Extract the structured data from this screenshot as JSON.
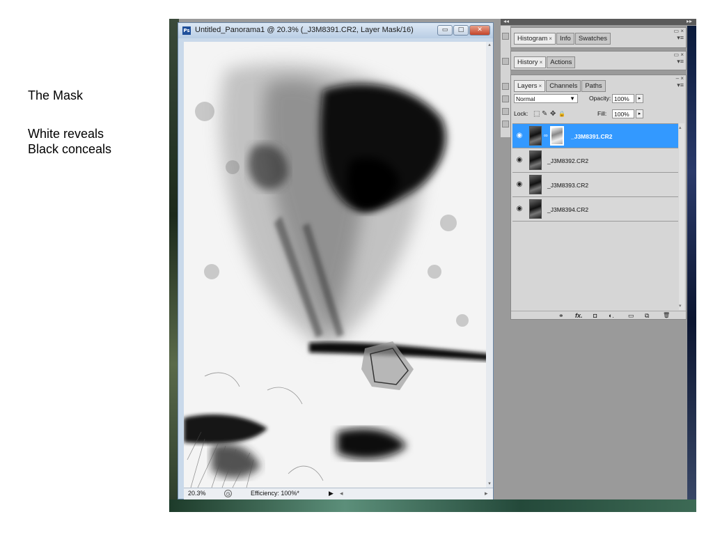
{
  "slide": {
    "title": "The Mask",
    "line1": "White reveals",
    "line2": "Black conceals"
  },
  "document": {
    "app_badge": "Ps",
    "title": "Untitled_Panorama1 @ 20.3% (_J3M8391.CR2, Layer Mask/16)",
    "minimize_glyph": "▭",
    "maximize_glyph": "□",
    "close_glyph": "✕",
    "status": {
      "zoom": "20.3%",
      "info_glyph": "◷",
      "efficiency": "Efficiency: 100%*",
      "arrow_glyph": "▶",
      "scroll_left_glyph": "◂",
      "scroll_right_glyph": "▸"
    },
    "scroll_up_glyph": "▴",
    "scroll_down_glyph": "▾"
  },
  "panels": {
    "collapse_left": "◂◂",
    "collapse_right": "▸▸",
    "histogram_group": {
      "tabs": [
        "Histogram",
        "Info",
        "Swatches"
      ],
      "close_glyph": "×",
      "menu_glyph": "▾≡",
      "min_glyph": "▭ ×"
    },
    "history_group": {
      "tabs": [
        "History",
        "Actions"
      ],
      "close_glyph": "×",
      "menu_glyph": "▾≡",
      "min_glyph": "▭ ×"
    },
    "layers_group": {
      "tabs": [
        "Layers",
        "Channels",
        "Paths"
      ],
      "close_glyph": "×",
      "menu_glyph": "▾≡",
      "min_glyph": "– ×",
      "blend_mode": "Normal",
      "blend_arrow": "▼",
      "opacity_label": "Opacity:",
      "opacity_value": "100%",
      "stepper_glyph": "▸",
      "lock_label": "Lock:",
      "lock_icons": [
        "⬚",
        "✎",
        "✥",
        "🔒"
      ],
      "fill_label": "Fill:",
      "fill_value": "100%",
      "eye_glyph": "◉",
      "chain_glyph": "∞",
      "layers": [
        {
          "name": "_J3M8391.CR2",
          "selected": true
        },
        {
          "name": "_J3M8392.CR2",
          "selected": false
        },
        {
          "name": "_J3M8393.CR2",
          "selected": false
        },
        {
          "name": "_J3M8394.CR2",
          "selected": false
        }
      ],
      "scroll_up_glyph": "▴",
      "scroll_down_glyph": "▾",
      "footer_icons": {
        "link": "⚭",
        "fx": "fx.",
        "mask": "◘",
        "adjust": "◐.",
        "group": "▭",
        "new": "⧉",
        "delete": "🗑"
      }
    }
  },
  "colors": {
    "selection": "#3399ff",
    "panel_bg": "#d6d6d6",
    "workspace_bg": "#9a9a9a",
    "window_frame": "#c9d9ea"
  }
}
